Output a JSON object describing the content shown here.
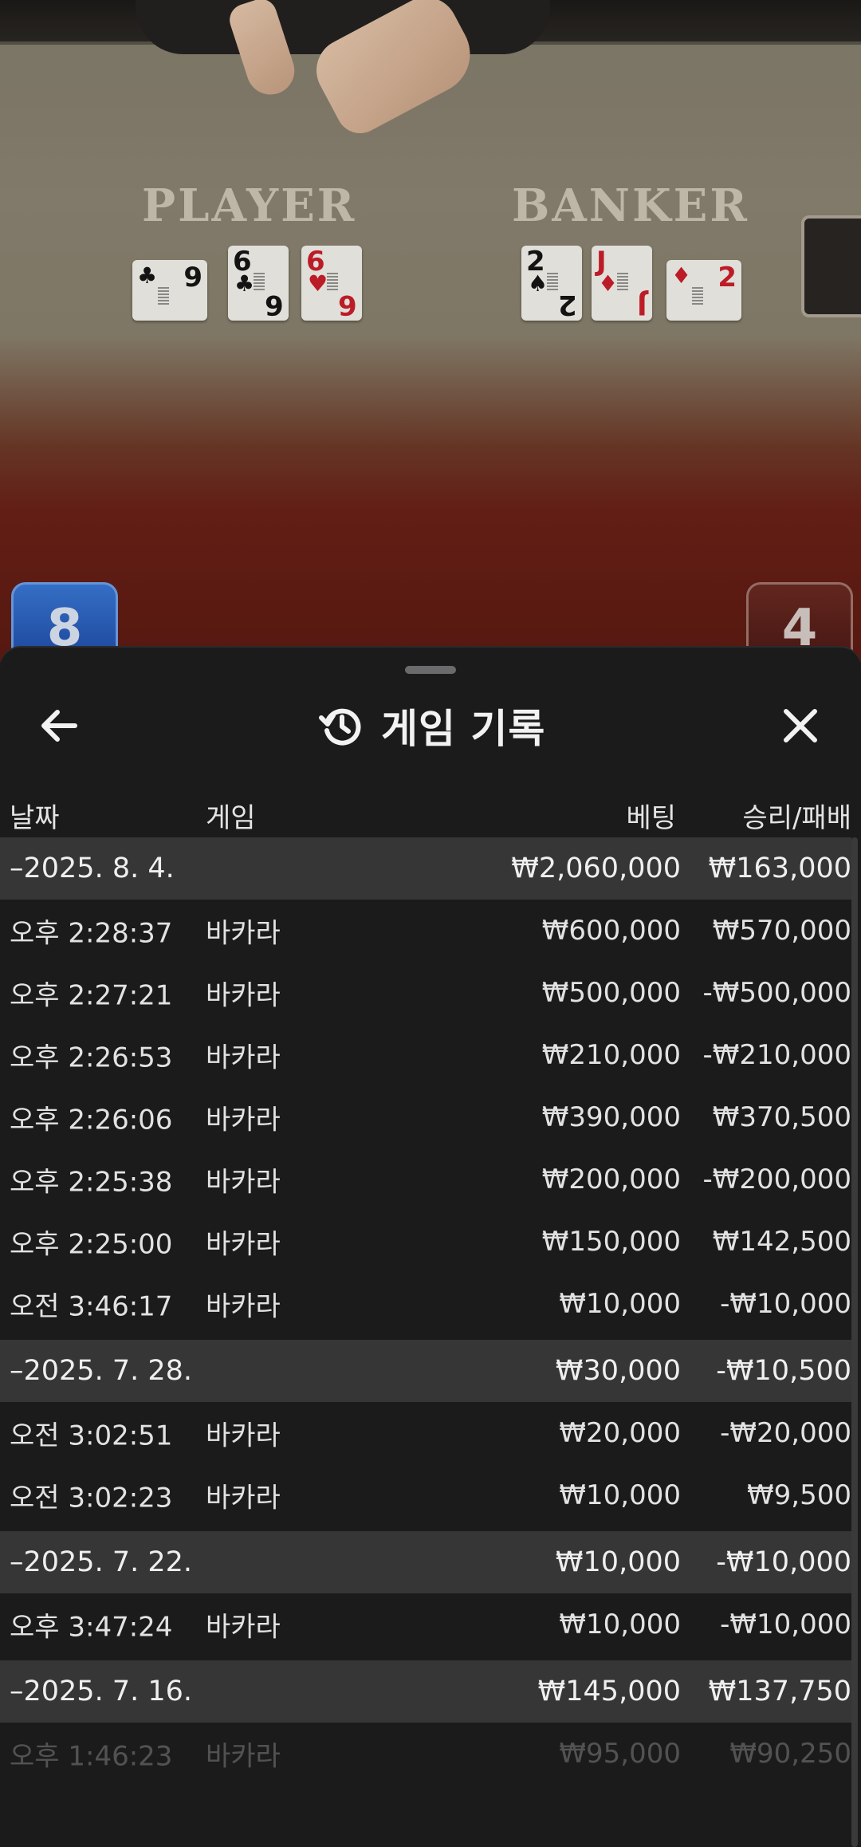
{
  "scene": {
    "player_label": "PLAYER",
    "banker_label": "BANKER",
    "player_score": "8",
    "banker_score": "4",
    "player_cards": [
      {
        "rank": "9",
        "suit": "♣",
        "color": "black"
      },
      {
        "rank": "6",
        "suit": "♣",
        "color": "black"
      },
      {
        "rank": "6",
        "suit": "♥",
        "color": "red"
      }
    ],
    "banker_cards": [
      {
        "rank": "2",
        "suit": "♠",
        "color": "black"
      },
      {
        "rank": "J",
        "suit": "♦",
        "color": "red"
      },
      {
        "rank": "2",
        "suit": "♦",
        "color": "red"
      }
    ]
  },
  "sheet": {
    "title": "게임 기록",
    "icons": {
      "back": "arrow-left-icon",
      "history": "history-icon",
      "close": "close-icon"
    },
    "columns": {
      "date": "날짜",
      "game": "게임",
      "bet": "베팅",
      "win_loss": "승리/패배"
    },
    "rows": [
      {
        "type": "group",
        "date": "–2025. 8. 4.",
        "game": "",
        "bet": "₩2,060,000",
        "win": "₩163,000"
      },
      {
        "type": "item",
        "date": "오후 2:28:37",
        "game": "바카라",
        "bet": "₩600,000",
        "win": "₩570,000"
      },
      {
        "type": "item",
        "date": "오후 2:27:21",
        "game": "바카라",
        "bet": "₩500,000",
        "win": "-₩500,000"
      },
      {
        "type": "item",
        "date": "오후 2:26:53",
        "game": "바카라",
        "bet": "₩210,000",
        "win": "-₩210,000"
      },
      {
        "type": "item",
        "date": "오후 2:26:06",
        "game": "바카라",
        "bet": "₩390,000",
        "win": "₩370,500"
      },
      {
        "type": "item",
        "date": "오후 2:25:38",
        "game": "바카라",
        "bet": "₩200,000",
        "win": "-₩200,000"
      },
      {
        "type": "item",
        "date": "오후 2:25:00",
        "game": "바카라",
        "bet": "₩150,000",
        "win": "₩142,500"
      },
      {
        "type": "item",
        "date": "오전 3:46:17",
        "game": "바카라",
        "bet": "₩10,000",
        "win": "-₩10,000"
      },
      {
        "type": "group",
        "date": "–2025. 7. 28.",
        "game": "",
        "bet": "₩30,000",
        "win": "-₩10,500"
      },
      {
        "type": "item",
        "date": "오전 3:02:51",
        "game": "바카라",
        "bet": "₩20,000",
        "win": "-₩20,000"
      },
      {
        "type": "item",
        "date": "오전 3:02:23",
        "game": "바카라",
        "bet": "₩10,000",
        "win": "₩9,500"
      },
      {
        "type": "group",
        "date": "–2025. 7. 22.",
        "game": "",
        "bet": "₩10,000",
        "win": "-₩10,000"
      },
      {
        "type": "item",
        "date": "오후 3:47:24",
        "game": "바카라",
        "bet": "₩10,000",
        "win": "-₩10,000"
      },
      {
        "type": "group",
        "date": "–2025. 7. 16.",
        "game": "",
        "bet": "₩145,000",
        "win": "₩137,750"
      },
      {
        "type": "item",
        "date": "오후 1:46:23",
        "game": "바카라",
        "bet": "₩95,000",
        "win": "₩90,250",
        "faded": true
      }
    ]
  }
}
